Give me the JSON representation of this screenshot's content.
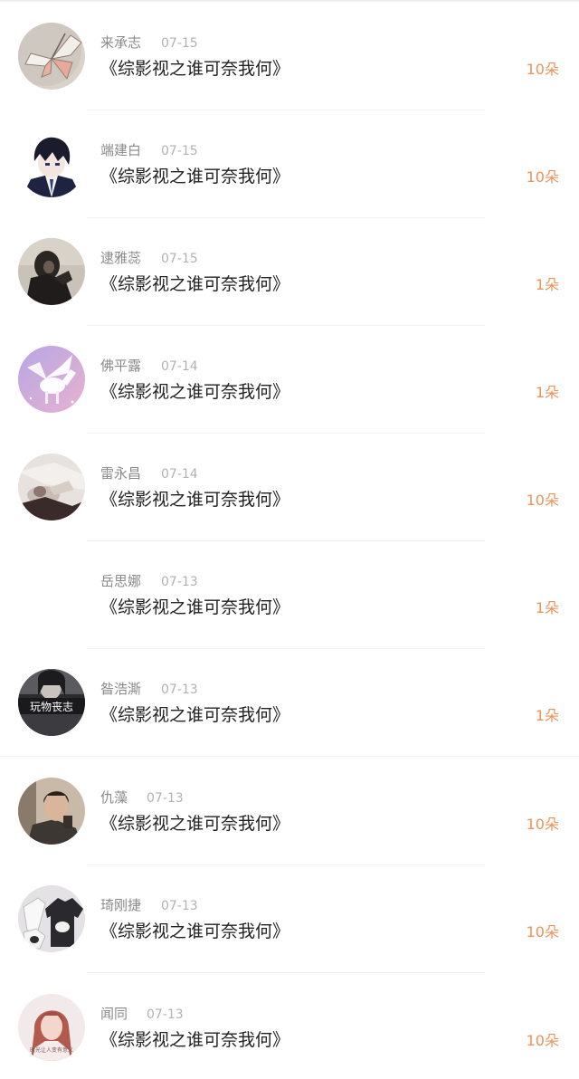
{
  "rows": [
    {
      "name": "来承志",
      "date": "07-15",
      "title": "《综影视之谁可奈我何》",
      "amount": "10朵",
      "avatar": "butterfly-avatar"
    },
    {
      "name": "端建白",
      "date": "07-15",
      "title": "《综影视之谁可奈我何》",
      "amount": "10朵",
      "avatar": "anime-boy-avatar"
    },
    {
      "name": "逮雅蕊",
      "date": "07-15",
      "title": "《综影视之谁可奈我何》",
      "amount": "1朵",
      "avatar": "dark-figure-avatar"
    },
    {
      "name": "佛平露",
      "date": "07-14",
      "title": "《综影视之谁可奈我何》",
      "amount": "1朵",
      "avatar": "pegasus-avatar"
    },
    {
      "name": "雷永昌",
      "date": "07-14",
      "title": "《综影视之谁可奈我何》",
      "amount": "10朵",
      "avatar": "sleeping-figure-avatar"
    },
    {
      "name": "岳思娜",
      "date": "07-13",
      "title": "《综影视之谁可奈我何》",
      "amount": "1朵",
      "avatar": "blank-avatar"
    },
    {
      "name": "昝浩澌",
      "date": "07-13",
      "title": "《综影视之谁可奈我何》",
      "amount": "1朵",
      "avatar": "text-photo-avatar",
      "avatar_text": "玩物丧志"
    },
    {
      "name": "仇藻",
      "date": "07-13",
      "title": "《综影视之谁可奈我何》",
      "amount": "10朵",
      "avatar": "man-photo-avatar"
    },
    {
      "name": "琦刚捷",
      "date": "07-13",
      "title": "《综影视之谁可奈我何》",
      "amount": "10朵",
      "avatar": "tshirt-avatar"
    },
    {
      "name": "闻同",
      "date": "07-13",
      "title": "《综影视之谁可奈我何》",
      "amount": "10朵",
      "avatar": "woman-photo-avatar",
      "avatar_text": "时光让人变有意义"
    }
  ],
  "colors": {
    "amount": "#e9945a",
    "name": "#8a8a8a",
    "date": "#b2b2b2",
    "title": "#222222"
  }
}
